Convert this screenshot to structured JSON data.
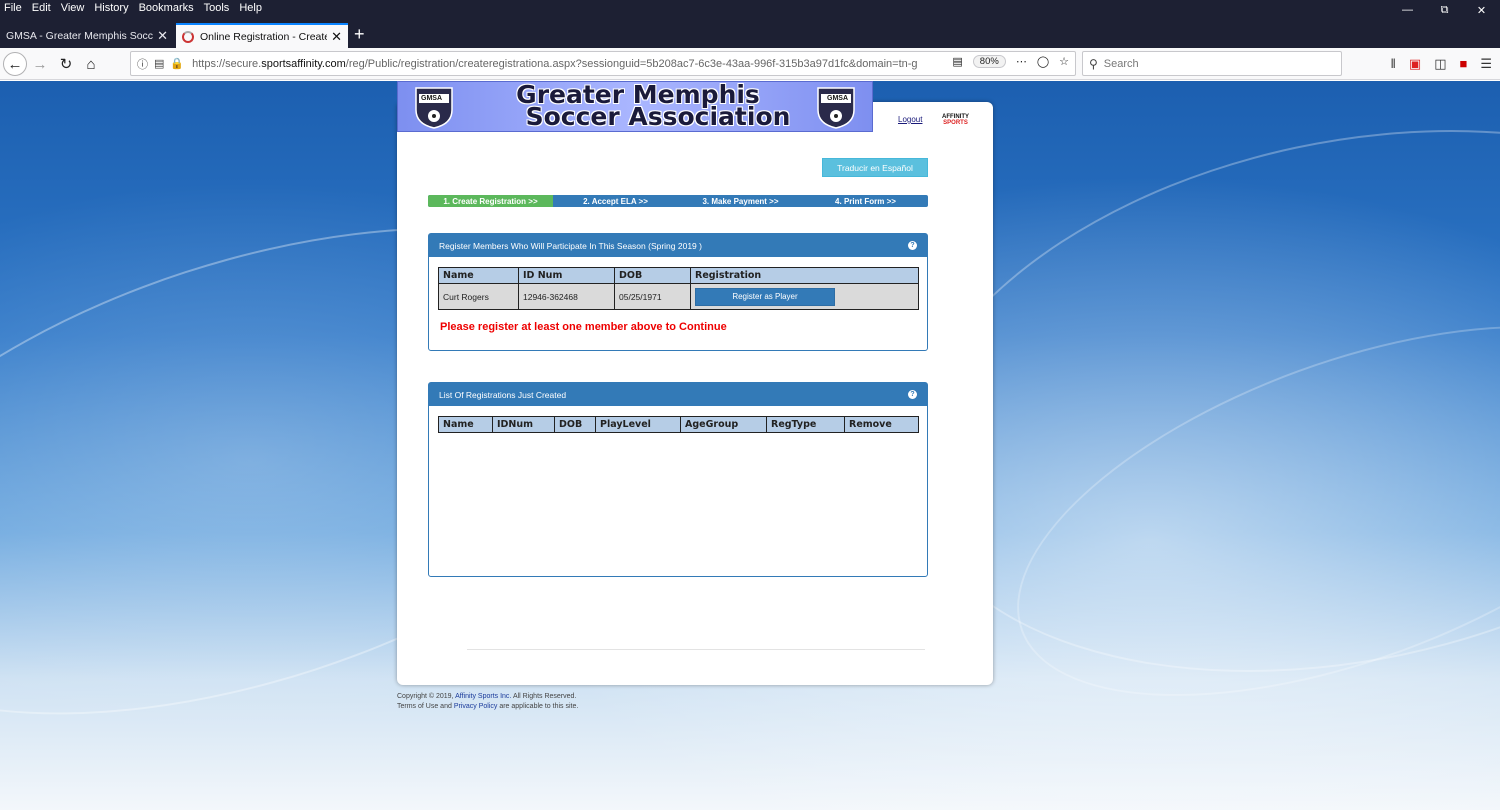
{
  "browser": {
    "menu": [
      "File",
      "Edit",
      "View",
      "History",
      "Bookmarks",
      "Tools",
      "Help"
    ],
    "tabs": [
      {
        "label": "GMSA - Greater Memphis Socccer /"
      },
      {
        "label": "Online Registration - Create Re"
      }
    ],
    "url_prefix": "https://secure.",
    "url_domain": "sportsaffinity.com",
    "url_rest": "/reg/Public/registration/createregistrationa.aspx?sessionguid=5b208ac7-6c3e-43aa-996f-315b3a97d1fc&domain=tn-g",
    "zoom": "80%",
    "search_placeholder": "Search"
  },
  "site": {
    "banner_line1": "Greater Memphis",
    "banner_line2": "Soccer Association",
    "logo_text": "GMSA",
    "logout": "Logout",
    "affinity_line1": "AFFINITY",
    "affinity_line2": "SPORTS",
    "translate_button": "Traducir en Español"
  },
  "steps": [
    {
      "label": "1. Create Registration >>",
      "active": true
    },
    {
      "label": "2. Accept ELA >>",
      "active": false
    },
    {
      "label": "3. Make Payment >>",
      "active": false
    },
    {
      "label": "4. Print Form >>",
      "active": false
    }
  ],
  "register_panel": {
    "title": "Register Members Who Will Participate In This Season (Spring 2019 )",
    "headers": [
      "Name",
      "ID Num",
      "DOB",
      "Registration"
    ],
    "rows": [
      {
        "name": "Curt Rogers",
        "id": "12946-362468",
        "dob": "05/25/1971",
        "button": "Register as Player"
      }
    ],
    "warning": "Please register at least one member above to Continue"
  },
  "list_panel": {
    "title": "List Of Registrations Just Created",
    "headers": [
      "Name",
      "IDNum",
      "DOB",
      "PlayLevel",
      "AgeGroup",
      "RegType",
      "Remove"
    ]
  },
  "footer": {
    "line1_a": "Copyright © 2019, ",
    "line1_link": "Affinity Sports Inc.",
    "line1_b": " All Rights Reserved.",
    "line2_a": "Terms of Use and ",
    "line2_link": "Privacy Policy",
    "line2_b": " are applicable to this site."
  }
}
